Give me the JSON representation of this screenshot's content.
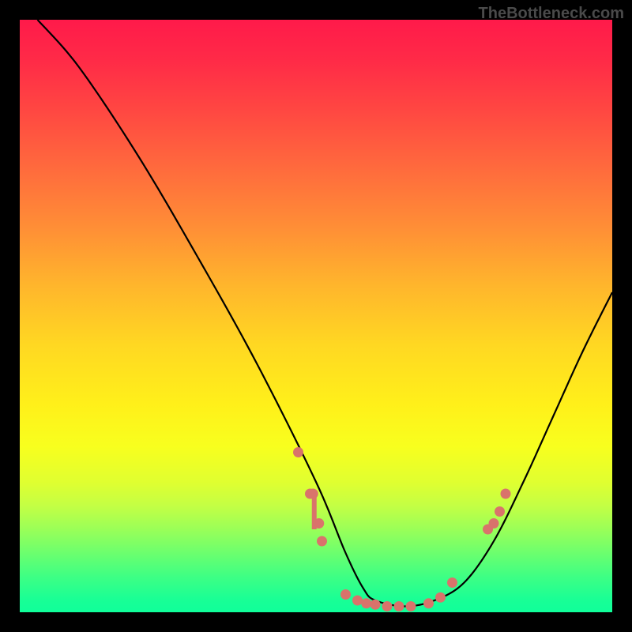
{
  "watermark": "TheBottleneck.com",
  "chart_data": {
    "type": "line",
    "title": "",
    "xlabel": "",
    "ylabel": "",
    "xlim": [
      0,
      100
    ],
    "ylim": [
      0,
      100
    ],
    "curve": {
      "name": "bottleneck-curve",
      "x": [
        3,
        10,
        20,
        30,
        40,
        50,
        55,
        58,
        60,
        65,
        70,
        75,
        80,
        85,
        90,
        95,
        100
      ],
      "y": [
        100,
        92,
        77,
        60,
        42,
        22,
        10,
        4,
        2,
        1,
        2,
        5,
        12,
        22,
        33,
        44,
        54
      ]
    },
    "markers": {
      "name": "data-points",
      "color": "#d9736b",
      "points": [
        {
          "x": 47,
          "y": 27
        },
        {
          "x": 49,
          "y": 20
        },
        {
          "x": 49.5,
          "y": 20
        },
        {
          "x": 50.5,
          "y": 15
        },
        {
          "x": 51,
          "y": 12
        },
        {
          "x": 55,
          "y": 3
        },
        {
          "x": 57,
          "y": 2
        },
        {
          "x": 58.5,
          "y": 1.5
        },
        {
          "x": 60,
          "y": 1.3
        },
        {
          "x": 62,
          "y": 1
        },
        {
          "x": 64,
          "y": 1
        },
        {
          "x": 66,
          "y": 1
        },
        {
          "x": 69,
          "y": 1.5
        },
        {
          "x": 71,
          "y": 2.5
        },
        {
          "x": 73,
          "y": 5
        },
        {
          "x": 79,
          "y": 14
        },
        {
          "x": 80,
          "y": 15
        },
        {
          "x": 81,
          "y": 17
        },
        {
          "x": 82,
          "y": 20
        }
      ]
    },
    "bar_segment": {
      "x": 49.7,
      "y_bottom": 14,
      "y_top": 20,
      "color": "#d9736b"
    }
  }
}
